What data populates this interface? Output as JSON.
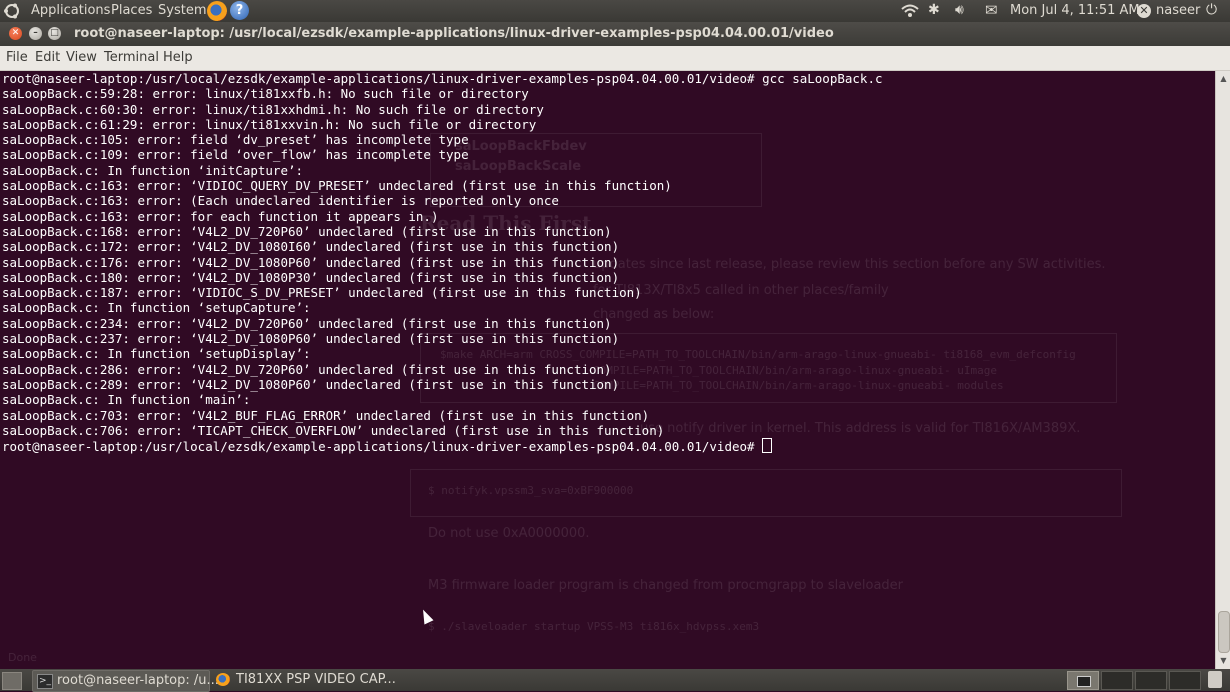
{
  "top_panel": {
    "applications": "Applications",
    "places": "Places",
    "system": "System",
    "clock": "Mon Jul  4, 11:51 AM",
    "user": "naseer"
  },
  "window": {
    "title": "root@naseer-laptop: /usr/local/ezsdk/example-applications/linux-driver-examples-psp04.04.00.01/video"
  },
  "menubar": {
    "file": "File",
    "edit": "Edit",
    "view": "View",
    "terminal": "Terminal",
    "help": "Help"
  },
  "terminal": {
    "lines": [
      "root@naseer-laptop:/usr/local/ezsdk/example-applications/linux-driver-examples-psp04.04.00.01/video# gcc saLoopBack.c",
      "saLoopBack.c:59:28: error: linux/ti81xxfb.h: No such file or directory",
      "saLoopBack.c:60:30: error: linux/ti81xxhdmi.h: No such file or directory",
      "saLoopBack.c:61:29: error: linux/ti81xxvin.h: No such file or directory",
      "saLoopBack.c:105: error: field ‘dv_preset’ has incomplete type",
      "saLoopBack.c:109: error: field ‘over_flow’ has incomplete type",
      "saLoopBack.c: In function ‘initCapture’:",
      "saLoopBack.c:163: error: ‘VIDIOC_QUERY_DV_PRESET’ undeclared (first use in this function)",
      "saLoopBack.c:163: error: (Each undeclared identifier is reported only once",
      "saLoopBack.c:163: error: for each function it appears in.)",
      "saLoopBack.c:168: error: ‘V4L2_DV_720P60’ undeclared (first use in this function)",
      "saLoopBack.c:172: error: ‘V4L2_DV_1080I60’ undeclared (first use in this function)",
      "saLoopBack.c:176: error: ‘V4L2_DV_1080P60’ undeclared (first use in this function)",
      "saLoopBack.c:180: error: ‘V4L2_DV_1080P30’ undeclared (first use in this function)",
      "saLoopBack.c:187: error: ‘VIDIOC_S_DV_PRESET’ undeclared (first use in this function)",
      "saLoopBack.c: In function ‘setupCapture’:",
      "saLoopBack.c:234: error: ‘V4L2_DV_720P60’ undeclared (first use in this function)",
      "saLoopBack.c:237: error: ‘V4L2_DV_1080P60’ undeclared (first use in this function)",
      "saLoopBack.c: In function ‘setupDisplay’:",
      "saLoopBack.c:286: error: ‘V4L2_DV_720P60’ undeclared (first use in this function)",
      "saLoopBack.c:289: error: ‘V4L2_DV_1080P60’ undeclared (first use in this function)",
      "saLoopBack.c: In function ‘main’:",
      "saLoopBack.c:703: error: ‘V4L2_BUF_FLAG_ERROR’ undeclared (first use in this function)",
      "saLoopBack.c:706: error: ‘TICAPT_CHECK_OVERFLOW’ undeclared (first use in this function)"
    ],
    "prompt": "root@naseer-laptop:/usr/local/ezsdk/example-applications/linux-driver-examples-psp04.04.00.01/video# "
  },
  "background_ghost": {
    "link1": "saLoopBackFbdev",
    "link2": "saLoopBackScale",
    "heading": "Read This First",
    "line1": "updates since last release, please review this section before any SW activities.",
    "line2": "for TI813X/TI8x5 called in other places/family",
    "line3": "changed as below:",
    "code1": "$make ARCH=arm CROSS_COMPILE=PATH_TO_TOOLCHAIN/bin/arm-arago-linux-gnueabi- ti8168_evm_defconfig",
    "code2": "COMPILE=PATH_TO_TOOLCHAIN/bin/arm-arago-linux-gnueabi- uImage",
    "code3": "COMPILE=PATH_TO_TOOLCHAIN/bin/arm-arago-linux-gnueabi- modules",
    "line4": "use notify driver in kernel. This address is valid for TI816X/AM389X.",
    "code4": "$ notifyk.vpssm3_sva=0xBF900000",
    "bullet1": "Do not use 0xA0000000.",
    "bullet2": "M3 firmware loader program is changed from procmgrapp to slaveloader",
    "code5": "$ ./slaveloader startup VPSS-M3 ti816x_hdvpss.xem3",
    "status": "Done"
  },
  "taskbar": {
    "terminal_task": "root@naseer-laptop: /u...",
    "firefox_task": "TI81XX PSP VIDEO CAP..."
  }
}
